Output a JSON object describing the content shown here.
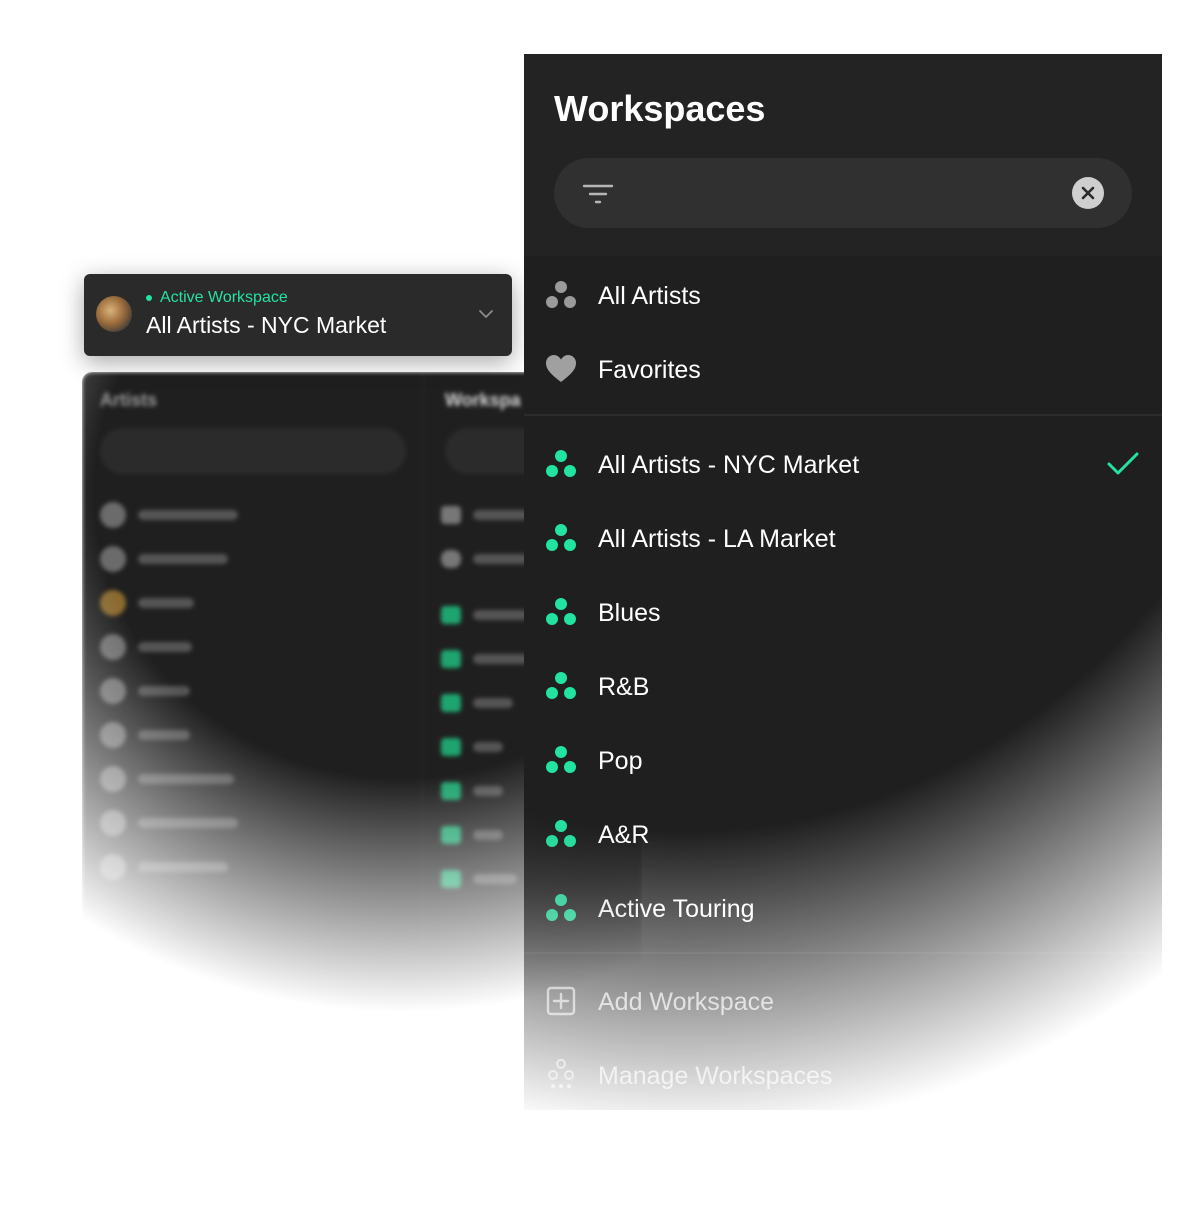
{
  "active_workspace": {
    "status_label": "Active Workspace",
    "name": "All Artists - NYC Market",
    "accent_color": "#23e3a0"
  },
  "panel": {
    "title": "Workspaces",
    "search": {
      "placeholder": "",
      "value": ""
    },
    "general_items": [
      {
        "label": "All Artists",
        "icon": "workspace-dots-icon"
      },
      {
        "label": "Favorites",
        "icon": "heart-icon"
      }
    ],
    "workspaces": [
      {
        "label": "All Artists - NYC Market",
        "selected": true
      },
      {
        "label": "All Artists - LA Market",
        "selected": false
      },
      {
        "label": "Blues",
        "selected": false
      },
      {
        "label": "R&B",
        "selected": false
      },
      {
        "label": "Pop",
        "selected": false
      },
      {
        "label": "A&R",
        "selected": false
      },
      {
        "label": "Active Touring",
        "selected": false
      }
    ],
    "actions": [
      {
        "label": "Add Workspace",
        "icon": "plus-square-icon"
      },
      {
        "label": "Manage Workspaces",
        "icon": "manage-dots-icon"
      }
    ]
  },
  "background_app": {
    "left_title": "Artists",
    "right_title": "Workspa"
  }
}
